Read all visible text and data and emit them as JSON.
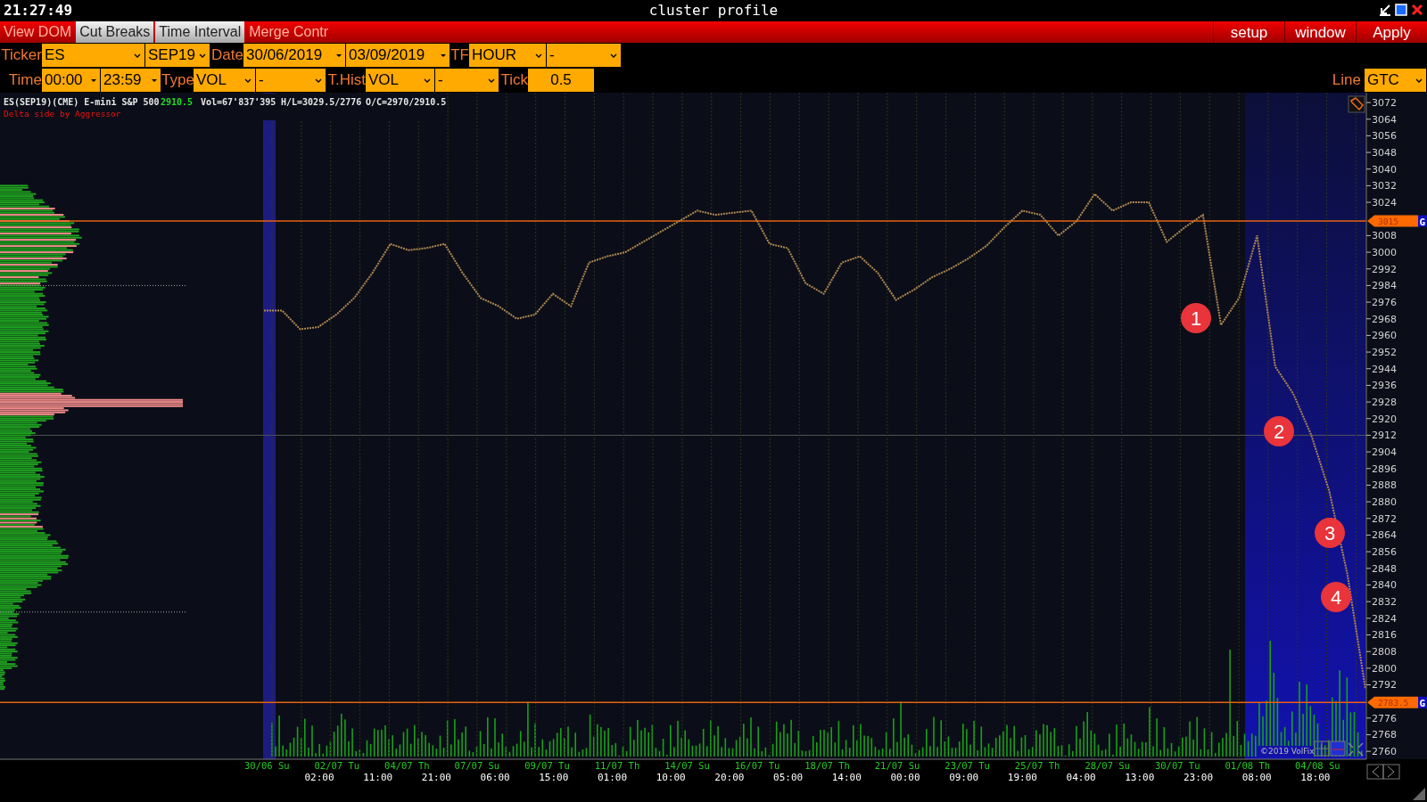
{
  "window": {
    "clock": "21:27:49",
    "title": "cluster profile"
  },
  "menu": {
    "toggles": [
      {
        "label": "View DOM",
        "on": false
      },
      {
        "label": "Cut Breaks",
        "on": true
      },
      {
        "label": "Time Interval",
        "on": true
      },
      {
        "label": "Merge Contr",
        "on": false
      }
    ],
    "buttons": [
      "setup",
      "window",
      "Apply"
    ]
  },
  "controls": [
    [
      {
        "kind": "label",
        "text": "Ticker"
      },
      {
        "kind": "select",
        "value": "ES"
      },
      {
        "kind": "select",
        "value": "SEP19"
      },
      {
        "kind": "label",
        "text": "Date"
      },
      {
        "kind": "picker",
        "value": "30/06/2019"
      },
      {
        "kind": "picker",
        "value": "03/09/2019"
      },
      {
        "kind": "label",
        "text": "TF"
      },
      {
        "kind": "select",
        "value": "HOUR"
      },
      {
        "kind": "select",
        "value": "-"
      }
    ],
    [
      {
        "kind": "label",
        "text": "Time"
      },
      {
        "kind": "picker",
        "value": "00:00"
      },
      {
        "kind": "picker",
        "value": "23:59"
      },
      {
        "kind": "label",
        "text": "Type"
      },
      {
        "kind": "select",
        "value": "VOL"
      },
      {
        "kind": "select",
        "value": "-"
      },
      {
        "kind": "label",
        "text": "T.Hist"
      },
      {
        "kind": "select",
        "value": "VOL"
      },
      {
        "kind": "select",
        "value": "-"
      },
      {
        "kind": "label",
        "text": "Tick"
      },
      {
        "kind": "input",
        "value": "0.5"
      }
    ]
  ],
  "line_control": {
    "label": "Line",
    "value": "GTC"
  },
  "chart": {
    "info": [
      {
        "text": "ES(SEP19)(CME) E-mini S&P 500",
        "color": "#e6e6e6"
      },
      {
        "text": "2910.5",
        "color": "#22dd22"
      },
      {
        "text": "Vol=67'837'395",
        "color": "#e6e6e6"
      },
      {
        "text": "H/L=3029.5/2776",
        "color": "#e6e6e6"
      },
      {
        "text": "O/C=2970/2910.5",
        "color": "#e6e6e6"
      }
    ],
    "note": "Delta side by Aggressor",
    "copyright": "©2019 VolFix",
    "level_tags": [
      "G",
      "G"
    ],
    "markers": [
      {
        "label": "1"
      },
      {
        "label": "2"
      },
      {
        "label": "3"
      },
      {
        "label": "4"
      }
    ],
    "date_labels": [
      "30/06 Su",
      "02/07 Tu",
      "04/07 Th",
      "07/07 Su",
      "09/07 Tu",
      "11/07 Th",
      "14/07 Su",
      "16/07 Tu",
      "18/07 Th",
      "21/07 Su",
      "23/07 Tu",
      "25/07 Th",
      "28/07 Su",
      "30/07 Tu",
      "01/08 Th",
      "04/08 Su"
    ],
    "time_labels": [
      "02:00",
      "11:00",
      "21:00",
      "06:00",
      "15:00",
      "01:00",
      "10:00",
      "20:00",
      "05:00",
      "14:00",
      "00:00",
      "09:00",
      "19:00",
      "04:00",
      "13:00",
      "23:00",
      "08:00",
      "18:00"
    ],
    "chart_data": {
      "type": "line",
      "ylim": [
        2756,
        3076
      ],
      "grid": true,
      "yticks": [
        3072,
        3064,
        3056,
        3048,
        3040,
        3032,
        3024,
        3008,
        3000,
        2992,
        2984,
        2976,
        2968,
        2960,
        2952,
        2944,
        2936,
        2928,
        2920,
        2912,
        2904,
        2896,
        2888,
        2880,
        2872,
        2864,
        2856,
        2848,
        2840,
        2832,
        2824,
        2816,
        2808,
        2800,
        2792,
        2776,
        2768,
        2760
      ],
      "series": [
        {
          "color": "#b08850",
          "line_style": "dashed",
          "values": [
            2972,
            2972,
            2963,
            2964,
            2970,
            2978,
            2990,
            3004,
            3001,
            3002,
            3004,
            2990,
            2978,
            2974,
            2968,
            2970,
            2980,
            2974,
            2995,
            2998,
            3000,
            3005,
            3010,
            3015,
            3020,
            3018,
            3019,
            3020,
            3004,
            3002,
            2985,
            2980,
            2995,
            2998,
            2990,
            2977,
            2982,
            2988,
            2992,
            2997,
            3003,
            3012,
            3020,
            3018,
            3008,
            3015,
            3028,
            3020,
            3024,
            3024,
            3005,
            3012,
            3018,
            2965,
            2978,
            3008,
            2945,
            2932,
            2912,
            2885,
            2845,
            2790
          ]
        }
      ],
      "ref_lines": [
        {
          "axis": "y",
          "value": 3015,
          "label": "3015"
        },
        {
          "axis": "y",
          "value": 2783.5,
          "label": "2783.5"
        }
      ]
    }
  }
}
